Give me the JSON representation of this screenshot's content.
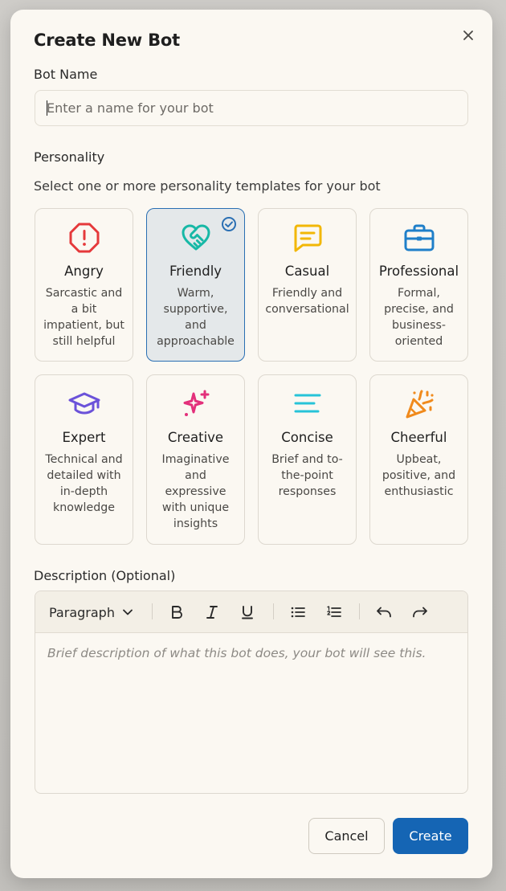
{
  "modal": {
    "title": "Create New Bot",
    "close_icon": "close-icon"
  },
  "bot_name": {
    "label": "Bot Name",
    "placeholder": "Enter a name for your bot",
    "value": ""
  },
  "personality": {
    "label": "Personality",
    "hint": "Select one or more personality templates for your bot",
    "cards": [
      {
        "id": "angry",
        "title": "Angry",
        "description": "Sarcastic and a bit impatient, but still helpful",
        "icon": "octagon-alert-icon",
        "color": "#e5393b",
        "selected": false
      },
      {
        "id": "friendly",
        "title": "Friendly",
        "description": "Warm, supportive, and approachable",
        "icon": "heart-handshake-icon",
        "color": "#17b8a6",
        "selected": true
      },
      {
        "id": "casual",
        "title": "Casual",
        "description": "Friendly and conversational",
        "icon": "message-square-text-icon",
        "color": "#f2b705",
        "selected": false
      },
      {
        "id": "professional",
        "title": "Professional",
        "description": "Formal, precise, and business-oriented",
        "icon": "briefcase-icon",
        "color": "#1f7fc9",
        "selected": false
      },
      {
        "id": "expert",
        "title": "Expert",
        "description": "Technical and detailed with in-depth knowledge",
        "icon": "graduation-cap-icon",
        "color": "#6b52d9",
        "selected": false
      },
      {
        "id": "creative",
        "title": "Creative",
        "description": "Imaginative and expressive with unique insights",
        "icon": "sparkles-icon",
        "color": "#e3307b",
        "selected": false
      },
      {
        "id": "concise",
        "title": "Concise",
        "description": "Brief and to-the-point responses",
        "icon": "align-left-icon",
        "color": "#27c3d8",
        "selected": false
      },
      {
        "id": "cheerful",
        "title": "Cheerful",
        "description": "Upbeat, positive, and enthusiastic",
        "icon": "party-popper-icon",
        "color": "#f08a1c",
        "selected": false
      }
    ],
    "selected_check_color": "#2a6fb3"
  },
  "description": {
    "label": "Description (Optional)",
    "toolbar": {
      "block_type": "Paragraph",
      "bold_label": "B",
      "italic_label": "I",
      "underline_label": "U"
    },
    "placeholder": "Brief description of what this bot does, your bot will see this."
  },
  "actions": {
    "cancel_label": "Cancel",
    "create_label": "Create",
    "primary_color": "#1565b4"
  }
}
